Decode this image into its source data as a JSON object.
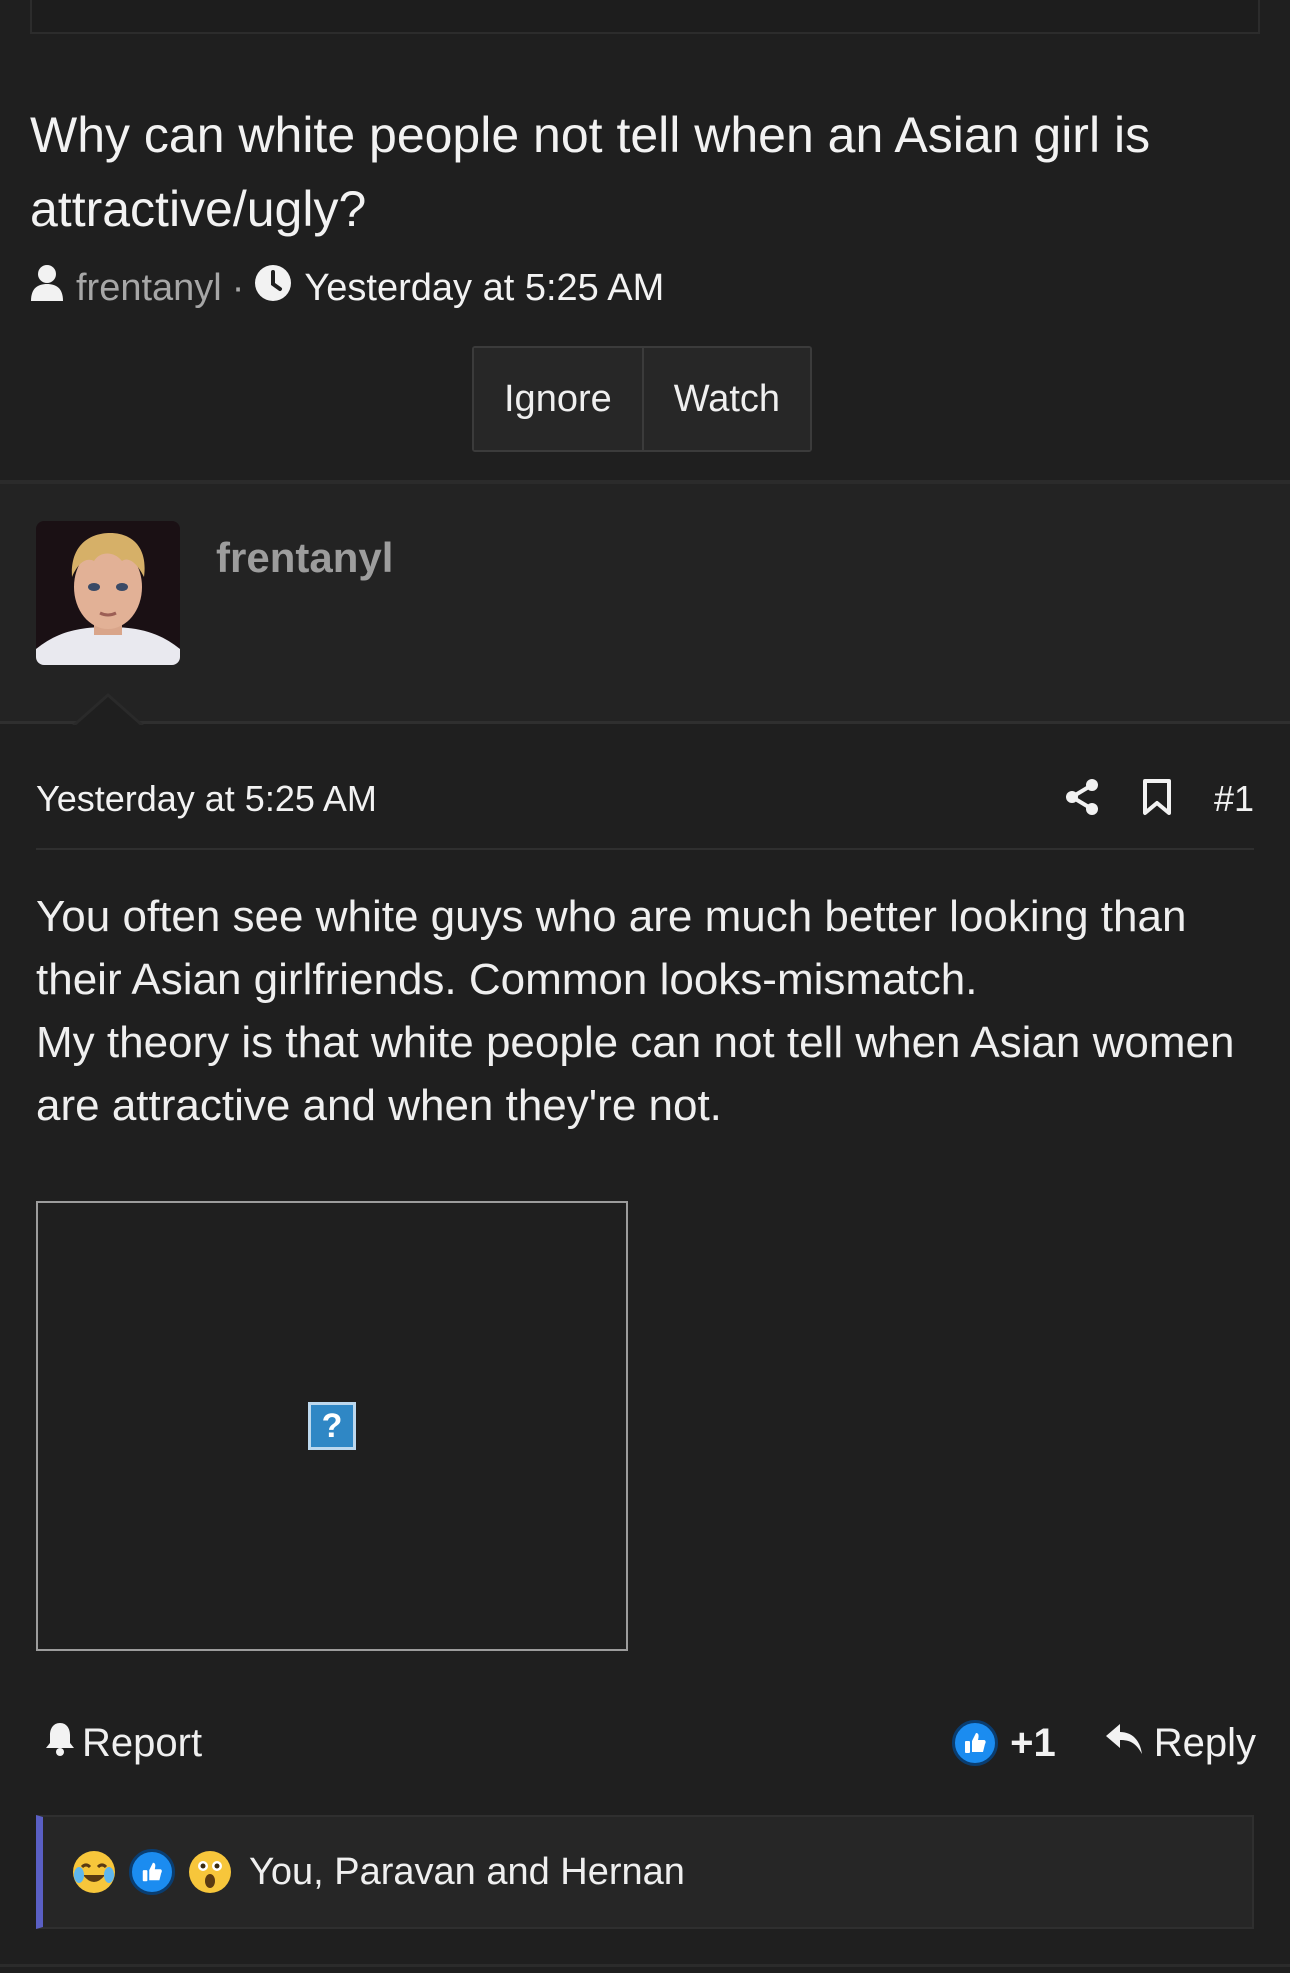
{
  "thread": {
    "title": "Why can white people not tell when an Asian girl is attractive/ugly?",
    "author": "frentanyl",
    "separator": "·",
    "time": "Yesterday at 5:25 AM",
    "buttons": {
      "ignore": "Ignore",
      "watch": "Watch"
    }
  },
  "post": {
    "username": "frentanyl",
    "date": "Yesterday at 5:25 AM",
    "number": "#1",
    "body_lines": [
      "You often see white guys who are much better looking than their Asian girlfriends. Common looks-mismatch.",
      "My theory is that white people can not tell when Asian women are attractive and when they're not."
    ],
    "broken_image_glyph": "?",
    "report_label": "Report",
    "like_count": "+1",
    "reply_label": "Reply",
    "reactions_text": "You, Paravan and Hernan"
  },
  "icons": {
    "author": "user-icon",
    "time": "clock-icon",
    "share": "share-icon",
    "bookmark": "bookmark-icon",
    "report": "bell-icon",
    "like": "thumbs-up-icon",
    "reply": "reply-arrow-icon",
    "reaction_1": "laughing-crying-emoji-icon",
    "reaction_2": "thumbs-up-reaction-icon",
    "reaction_3": "shocked-emoji-icon"
  },
  "colors": {
    "background": "#1f1f1f",
    "user_section": "#232323",
    "accent_bar": "#5a5fc4",
    "like_blue": "#1b8cf0"
  }
}
